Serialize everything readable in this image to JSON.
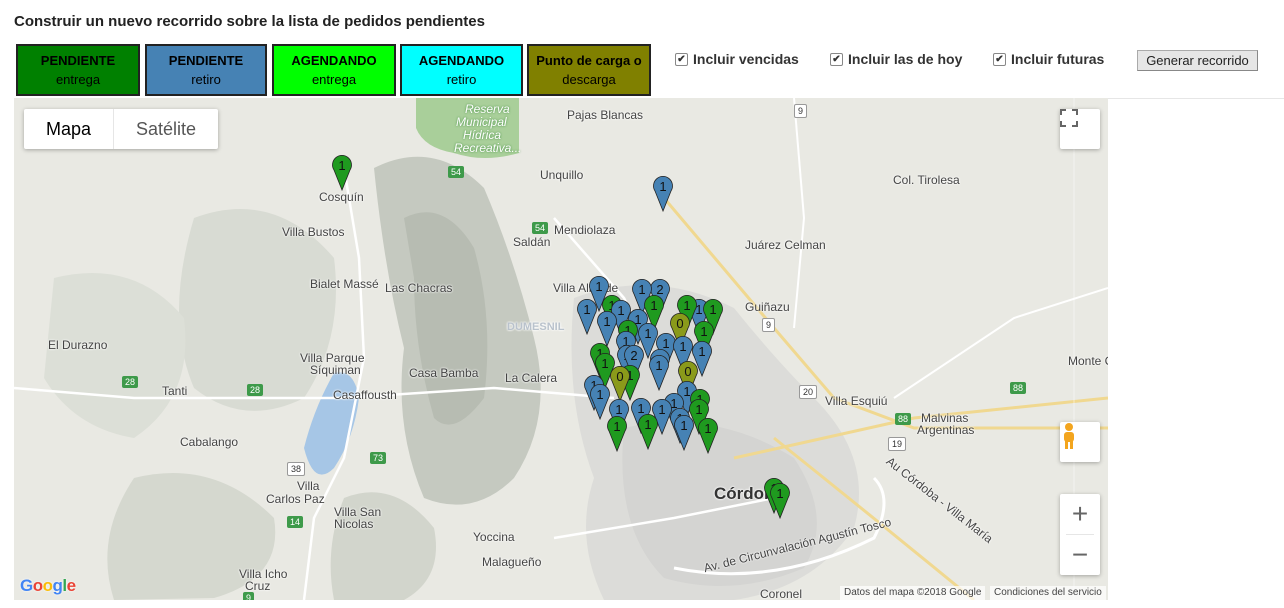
{
  "page": {
    "title": "Construir un nuevo recorrido sobre la lista de pedidos pendientes"
  },
  "legend": [
    {
      "title": "PENDIENTE",
      "sub": "entrega",
      "bg": "#008000",
      "fg": "#000000"
    },
    {
      "title": "PENDIENTE",
      "sub": "retiro",
      "bg": "#4682b4",
      "fg": "#000000"
    },
    {
      "title": "AGENDANDO",
      "sub": "entrega",
      "bg": "#00ff00",
      "fg": "#000000"
    },
    {
      "title": "AGENDANDO",
      "sub": "retiro",
      "bg": "#00ffff",
      "fg": "#000000"
    },
    {
      "title": "Punto de carga o",
      "sub": "descarga",
      "bg": "#808000",
      "fg": "#000000"
    }
  ],
  "filters": [
    {
      "label": "Incluir vencidas",
      "checked": true
    },
    {
      "label": "Incluir las de hoy",
      "checked": true
    },
    {
      "label": "Incluir futuras",
      "checked": true
    }
  ],
  "generate_button": "Generar recorrido",
  "map": {
    "type_map": "Mapa",
    "type_satellite": "Satélite",
    "fullscreen_icon": "fullscreen-icon",
    "pegman_icon": "pegman-icon",
    "zoom_in": "+",
    "zoom_out": "−",
    "attribution": "Datos del mapa ©2018 Google",
    "terms": "Condiciones del servicio",
    "logo": "Google",
    "places": [
      {
        "name": "Pajas Blancas"
      },
      {
        "name": "Reserva"
      },
      {
        "name": "Municipal"
      },
      {
        "name": "Hídrica"
      },
      {
        "name": "Recreativa..."
      },
      {
        "name": "Unquillo"
      },
      {
        "name": "Col. Tirolesa"
      },
      {
        "name": "Cosquín"
      },
      {
        "name": "Mendiolaza"
      },
      {
        "name": "Saldán"
      },
      {
        "name": "Villa Bustos"
      },
      {
        "name": "Juárez Celman"
      },
      {
        "name": "Bialet Massé"
      },
      {
        "name": "Las Chacras"
      },
      {
        "name": "Villa Allende"
      },
      {
        "name": "Guiñazu"
      },
      {
        "name": "DUMESNIL"
      },
      {
        "name": "El Durazno"
      },
      {
        "name": "Villa Parque"
      },
      {
        "name": "Síquiman"
      },
      {
        "name": "Casa Bamba"
      },
      {
        "name": "La Calera"
      },
      {
        "name": "Monte C"
      },
      {
        "name": "Tanti"
      },
      {
        "name": "Casaffousth"
      },
      {
        "name": "Villa Esquiú"
      },
      {
        "name": "Malvinas"
      },
      {
        "name": "Argentinas"
      },
      {
        "name": "Cabalango"
      },
      {
        "name": "Villa"
      },
      {
        "name": "Carlos Paz"
      },
      {
        "name": "Córdoba"
      },
      {
        "name": "Villa San"
      },
      {
        "name": "Nicolas"
      },
      {
        "name": "Yoccina"
      },
      {
        "name": "Malagueño"
      },
      {
        "name": "Villa Icho"
      },
      {
        "name": "Cruz"
      },
      {
        "name": "Coronel"
      },
      {
        "name": "Av. de Circunvalación Agustín Tosco"
      },
      {
        "name": "Au Córdoba - Villa María"
      }
    ],
    "shields": [
      "9",
      "54",
      "54",
      "9",
      "28",
      "28",
      "88",
      "88",
      "19",
      "38",
      "73",
      "14",
      "20",
      "9"
    ],
    "markers": [
      {
        "label": "1",
        "kind": "pend_entrega"
      },
      {
        "label": "1",
        "kind": "pend_retiro"
      },
      {
        "label": "1",
        "kind": "pend_retiro"
      },
      {
        "label": "1",
        "kind": "pend_retiro"
      },
      {
        "label": "2",
        "kind": "pend_retiro"
      },
      {
        "label": "1",
        "kind": "pend_retiro"
      },
      {
        "label": "1",
        "kind": "pend_entrega"
      },
      {
        "label": "1",
        "kind": "pend_entrega"
      },
      {
        "label": "1",
        "kind": "pend_retiro"
      },
      {
        "label": "1",
        "kind": "pend_retiro"
      },
      {
        "label": "1",
        "kind": "pend_entrega"
      },
      {
        "label": "1",
        "kind": "pend_retiro"
      },
      {
        "label": "1",
        "kind": "pend_entrega"
      },
      {
        "label": "1",
        "kind": "pend_entrega"
      },
      {
        "label": "1",
        "kind": "pend_retiro"
      },
      {
        "label": "1",
        "kind": "pend_retiro"
      },
      {
        "label": "0",
        "kind": "punto"
      },
      {
        "label": "1",
        "kind": "pend_retiro"
      },
      {
        "label": "1",
        "kind": "pend_entrega"
      },
      {
        "label": "1",
        "kind": "pend_retiro"
      },
      {
        "label": "1",
        "kind": "pend_retiro"
      },
      {
        "label": "2",
        "kind": "pend_retiro"
      },
      {
        "label": "1",
        "kind": "pend_retiro"
      },
      {
        "label": "1",
        "kind": "pend_retiro"
      },
      {
        "label": "1",
        "kind": "pend_retiro"
      },
      {
        "label": "1",
        "kind": "pend_entrega"
      },
      {
        "label": "1",
        "kind": "pend_entrega"
      },
      {
        "label": "1",
        "kind": "pend_entrega"
      },
      {
        "label": "1",
        "kind": "pend_retiro"
      },
      {
        "label": "0",
        "kind": "punto"
      },
      {
        "label": "1",
        "kind": "pend_retiro"
      },
      {
        "label": "1",
        "kind": "pend_retiro"
      },
      {
        "label": "0",
        "kind": "punto"
      },
      {
        "label": "1",
        "kind": "pend_retiro"
      },
      {
        "label": "1",
        "kind": "pend_retiro"
      },
      {
        "label": "1",
        "kind": "pend_entrega"
      },
      {
        "label": "1",
        "kind": "pend_retiro"
      },
      {
        "label": "1",
        "kind": "pend_retiro"
      },
      {
        "label": "1",
        "kind": "pend_retiro"
      },
      {
        "label": "1",
        "kind": "pend_entrega"
      },
      {
        "label": "1",
        "kind": "pend_retiro"
      },
      {
        "label": "1",
        "kind": "pend_entrega"
      },
      {
        "label": "1",
        "kind": "pend_retiro"
      },
      {
        "label": "1",
        "kind": "pend_entrega"
      },
      {
        "label": "1",
        "kind": "pend_entrega"
      },
      {
        "label": "1",
        "kind": "pend_entrega"
      },
      {
        "label": "1",
        "kind": "pend_entrega"
      }
    ],
    "marker_colors": {
      "pend_entrega": "#1f9a1f",
      "pend_retiro": "#4682b4",
      "punto": "#8a9a1a"
    }
  }
}
